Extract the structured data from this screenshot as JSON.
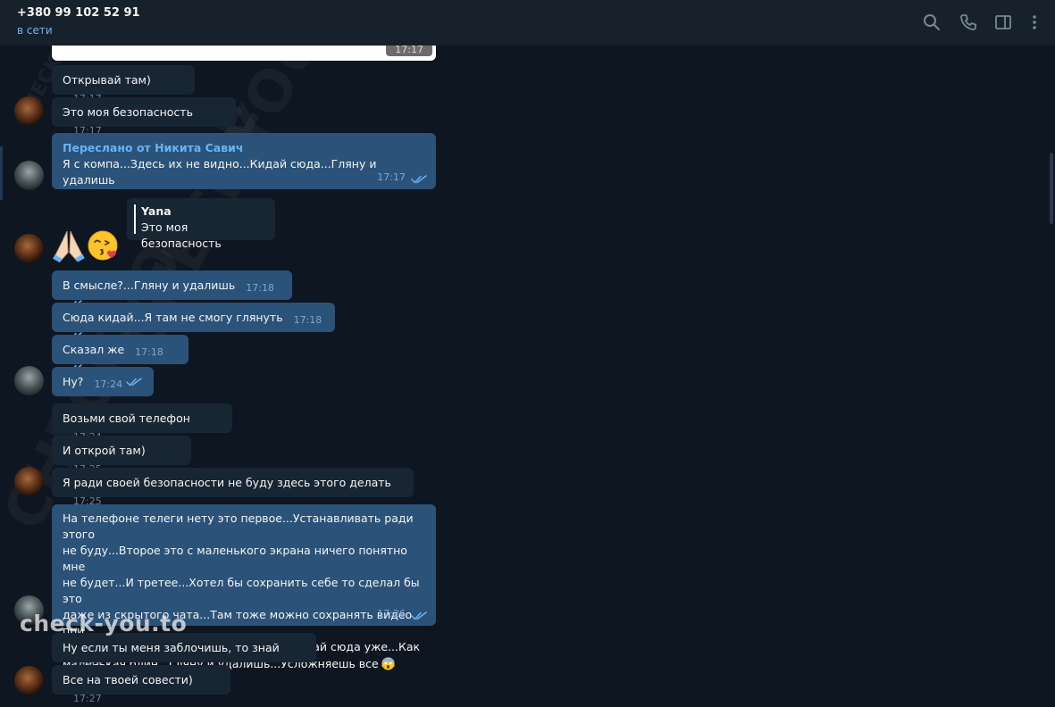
{
  "header": {
    "phone": "+380 99 102 52 91",
    "status": "в сети",
    "icons": [
      "search-icon",
      "phone-icon",
      "sidebar-toggle-icon",
      "more-icon"
    ]
  },
  "colors": {
    "background": "#0e1621",
    "header": "#17212b",
    "incoming_bubble": "#182533",
    "outgoing_bubble": "#2b5278",
    "link": "#6ab3f3",
    "read_ticks": "#6ab3f3"
  },
  "watermark": {
    "diagonal": "CHECK-YOU.ME",
    "footer": "check-you.to"
  },
  "messages": {
    "m0": {
      "time": "17:17"
    },
    "m1": {
      "text": "Открывай там)",
      "time": "17:17"
    },
    "m2": {
      "text": "Это моя безопасность",
      "time": "17:17"
    },
    "m3": {
      "forward_label": "Переслано от Никита Савич",
      "text": "Я с компа...Здесь их не видно...Кидай сюда...Гляну и удалишь",
      "time": "17:17"
    },
    "m4": {
      "reply_author": "Yana",
      "reply_text": "Это моя безопасность",
      "emojis": [
        "folded-hands-icon",
        "kissing-heart-face-icon"
      ]
    },
    "m5": {
      "text": "В смысле?...Гляну и удалишь",
      "time": "17:18"
    },
    "m6": {
      "text": "Сюда кидай...Я там не смогу глянуть",
      "time": "17:18"
    },
    "m7": {
      "text": "Сказал же",
      "time": "17:18"
    },
    "m8": {
      "text": "Ну?",
      "time": "17:24"
    },
    "m9": {
      "text": "Возьми свой телефон",
      "time": "17:24"
    },
    "m10": {
      "text": "И открой там)",
      "time": "17:25"
    },
    "m11": {
      "text": "Я ради своей безопасности не буду здесь этого делать",
      "time": "17:25"
    },
    "m12": {
      "lines": [
        "На телефоне телеги нету это первое...Устанавливать ради этого",
        "не буду...Второе это с маленького экрана ничего понятно мне",
        "не будет...И третее...Хотел бы сохранить себе то сделал бы это",
        "даже из скрытого чата...Там тоже можно сохранять видео при",
        "желании...Так что не морочь голову и кидай сюда уже...Как",
        "маленькая блин...Гляну и удалишь...Усложняешь все"
      ],
      "trailing_emoji": "screaming-face-icon",
      "time": "17:26"
    },
    "m13": {
      "text": "Ну если ты меня заблочишь, то знай",
      "time": "17:27"
    },
    "m14": {
      "text": "Все на твоей совести)",
      "time": "17:27"
    }
  }
}
